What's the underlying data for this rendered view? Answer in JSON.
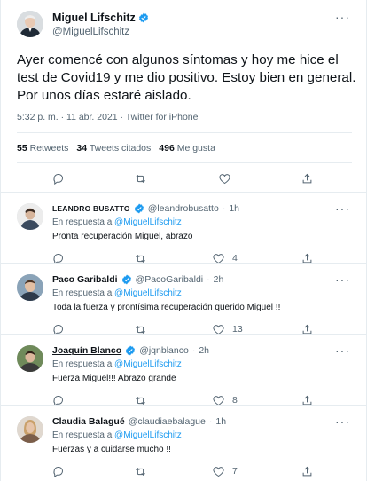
{
  "main_tweet": {
    "author_name": "Miguel Lifschitz",
    "author_handle": "@MiguelLifschitz",
    "more": "···",
    "text": "Ayer comencé con algunos síntomas y hoy me hice el test de Covid19 y me dio positivo. Estoy bien en general. Por unos días estaré aislado.",
    "meta": "5:32 p. m. · 11 abr. 2021 · Twitter for iPhone",
    "stats": {
      "retweets_count": "55",
      "retweets_label": "Retweets",
      "quotes_count": "34",
      "quotes_label": "Tweets citados",
      "likes_count": "496",
      "likes_label": "Me gusta"
    }
  },
  "in_reply_prefix": "En respuesta a",
  "replies": [
    {
      "name": "LEANDRO BUSATTO",
      "handle": "@leandrobusatto",
      "time": "1h",
      "reply_to": "@MiguelLifschitz",
      "text": "Pronta recuperación Miguel, abrazo",
      "likes": "4",
      "verified": true
    },
    {
      "name": "Paco Garibaldi",
      "handle": "@PacoGaribaldi",
      "time": "2h",
      "reply_to": "@MiguelLifschitz",
      "text": "Toda la fuerza y prontísima recuperación querido Miguel !!",
      "likes": "13",
      "verified": true
    },
    {
      "name": "Joaquín Blanco",
      "handle": "@jqnblanco",
      "time": "2h",
      "reply_to": "@MiguelLifschitz",
      "text": "Fuerza Miguel!!! Abrazo grande",
      "likes": "8",
      "verified": true
    },
    {
      "name": "Claudia Balagué",
      "handle": "@claudiaebalague",
      "time": "1h",
      "reply_to": "@MiguelLifschitz",
      "text": "Fuerzas y a cuidarse mucho !!",
      "likes": "7",
      "verified": false
    }
  ],
  "colors": {
    "accent": "#1d9bf0",
    "text": "#0f1419",
    "secondary": "#536471",
    "divider": "#e6ecf0"
  }
}
